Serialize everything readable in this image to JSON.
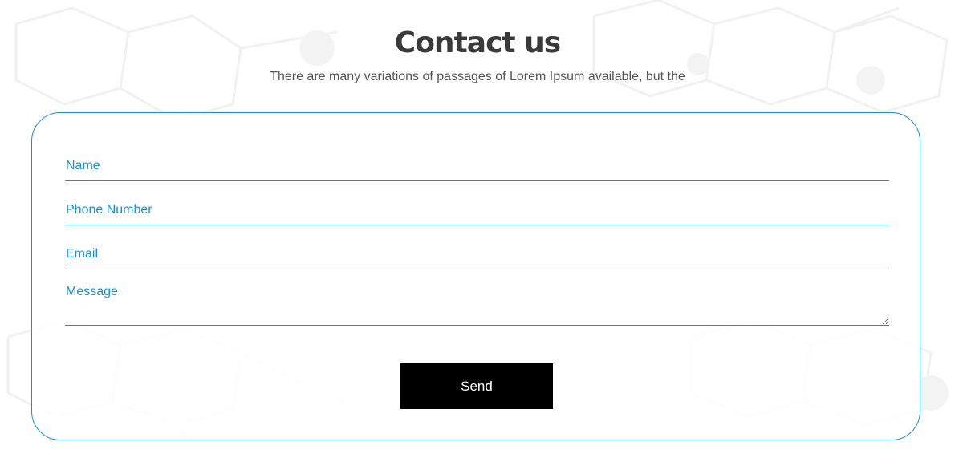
{
  "header": {
    "title": "Contact us",
    "subtitle": "There are many variations of passages of Lorem Ipsum available, but the"
  },
  "form": {
    "name_placeholder": "Name",
    "phone_placeholder": "Phone Number",
    "email_placeholder": "Email",
    "message_placeholder": "Message",
    "send_label": "Send"
  },
  "colors": {
    "accent": "#1a8fc9",
    "title": "#3a3a3a",
    "subtitle": "#555555",
    "button_bg": "#000000",
    "button_text": "#ffffff"
  }
}
